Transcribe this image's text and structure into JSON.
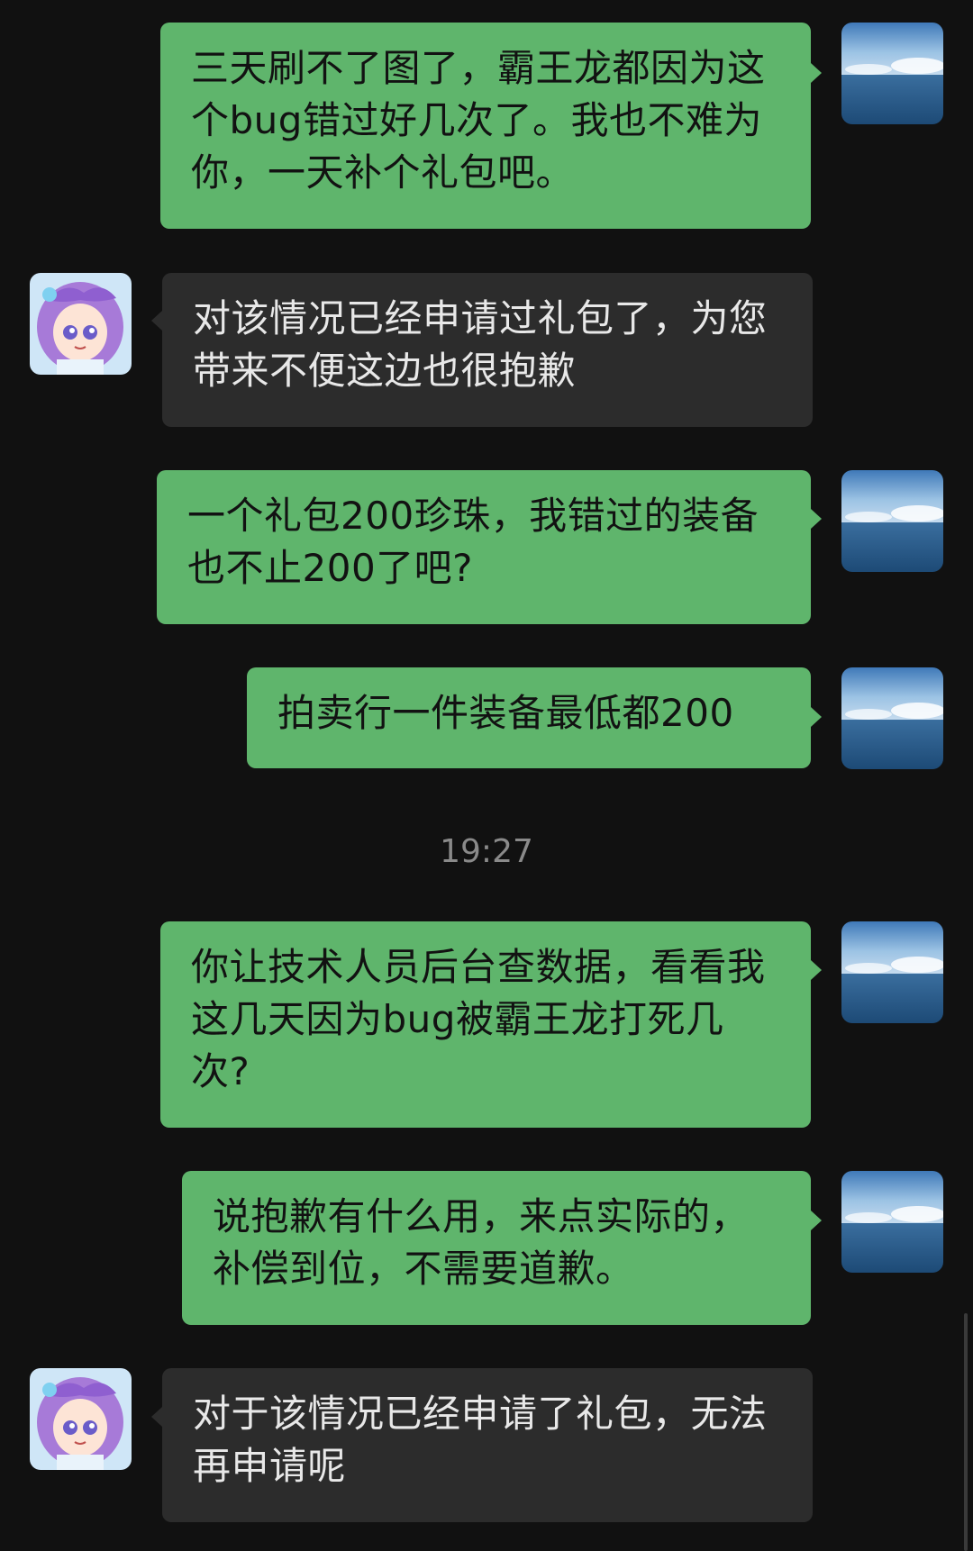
{
  "colors": {
    "background": "#111111",
    "outgoing_bubble": "#5fb56c",
    "incoming_bubble": "#2c2c2c",
    "timestamp_text": "#8a8a8a"
  },
  "avatars": {
    "me": "ocean-sky-avatar",
    "agent": "purple-haired-anime-girl-avatar"
  },
  "messages": [
    {
      "sender": "me",
      "text": "三天刷不了图了，霸王龙都因为这个bug错过好几次了。我也不难为你，一天补个礼包吧。"
    },
    {
      "sender": "agent",
      "text": "对该情况已经申请过礼包了，为您带来不便这边也很抱歉"
    },
    {
      "sender": "me",
      "text": "一个礼包200珍珠，我错过的装备也不止200了吧?"
    },
    {
      "sender": "me",
      "text": "拍卖行一件装备最低都200"
    },
    {
      "sender": "me",
      "text": "你让技术人员后台查数据，看看我这几天因为bug被霸王龙打死几次?"
    },
    {
      "sender": "me",
      "text": "说抱歉有什么用，来点实际的，补偿到位，不需要道歉。"
    },
    {
      "sender": "agent",
      "text": "对于该情况已经申请了礼包，无法再申请呢"
    }
  ],
  "timestamp": "19:27"
}
